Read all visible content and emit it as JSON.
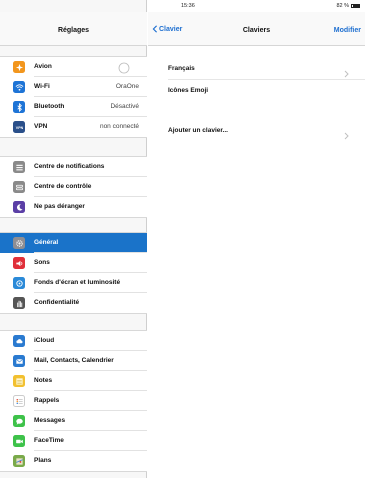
{
  "status_bar": {
    "device": "iPad",
    "time": "15:36",
    "battery": "82 %"
  },
  "sidebar": {
    "title": "Réglages",
    "groups": [
      [
        {
          "label": "Avion",
          "value": "",
          "icon": "airplane-icon",
          "color": "#f2961d",
          "toggle": true
        },
        {
          "label": "Wi-Fi",
          "value": "OraOne",
          "icon": "wifi-icon",
          "color": "#1e74d6"
        },
        {
          "label": "Bluetooth",
          "value": "Désactivé",
          "icon": "bluetooth-icon",
          "color": "#1e74d6"
        },
        {
          "label": "VPN",
          "value": "non connecté",
          "icon": "vpn-icon",
          "color": "#2a4f8a"
        }
      ],
      [
        {
          "label": "Centre de notifications",
          "value": "",
          "icon": "notifications-icon",
          "color": "#8a8a8a"
        },
        {
          "label": "Centre de contrôle",
          "value": "",
          "icon": "control-center-icon",
          "color": "#8a8a8a"
        },
        {
          "label": "Ne pas déranger",
          "value": "",
          "icon": "moon-icon",
          "color": "#5b3fa6"
        }
      ],
      [
        {
          "label": "Général",
          "value": "",
          "icon": "gear-icon",
          "color": "#8e8e93",
          "selected": true
        },
        {
          "label": "Sons",
          "value": "",
          "icon": "speaker-icon",
          "color": "#e0303a"
        },
        {
          "label": "Fonds d'écran et luminosité",
          "value": "",
          "icon": "wallpaper-icon",
          "color": "#2b8ad8"
        },
        {
          "label": "Confidentialité",
          "value": "",
          "icon": "hand-icon",
          "color": "#555555"
        }
      ],
      [
        {
          "label": "iCloud",
          "value": "",
          "icon": "cloud-icon",
          "color": "#2a7ad0"
        },
        {
          "label": "Mail, Contacts, Calendrier",
          "value": "",
          "icon": "mail-icon",
          "color": "#2a7ad0"
        },
        {
          "label": "Notes",
          "value": "",
          "icon": "notes-icon",
          "color": "#f2c030"
        },
        {
          "label": "Rappels",
          "value": "",
          "icon": "reminders-icon",
          "color": "#ffffff"
        },
        {
          "label": "Messages",
          "value": "",
          "icon": "messages-icon",
          "color": "#3ec24a"
        },
        {
          "label": "FaceTime",
          "value": "",
          "icon": "facetime-icon",
          "color": "#3ec24a"
        },
        {
          "label": "Plans",
          "value": "",
          "icon": "maps-icon",
          "color": "#7aaa4a"
        }
      ]
    ]
  },
  "main": {
    "back_label": "Clavier",
    "title": "Claviers",
    "edit_label": "Modifier",
    "groups": [
      [
        {
          "label": "Français",
          "chevron": true
        },
        {
          "label": "Icônes Emoji",
          "chevron": false
        }
      ],
      [
        {
          "label": "Ajouter un clavier...",
          "chevron": true
        }
      ]
    ]
  },
  "colors": {
    "accent": "#1e6fd0",
    "selected_row": "#1a73c9"
  }
}
